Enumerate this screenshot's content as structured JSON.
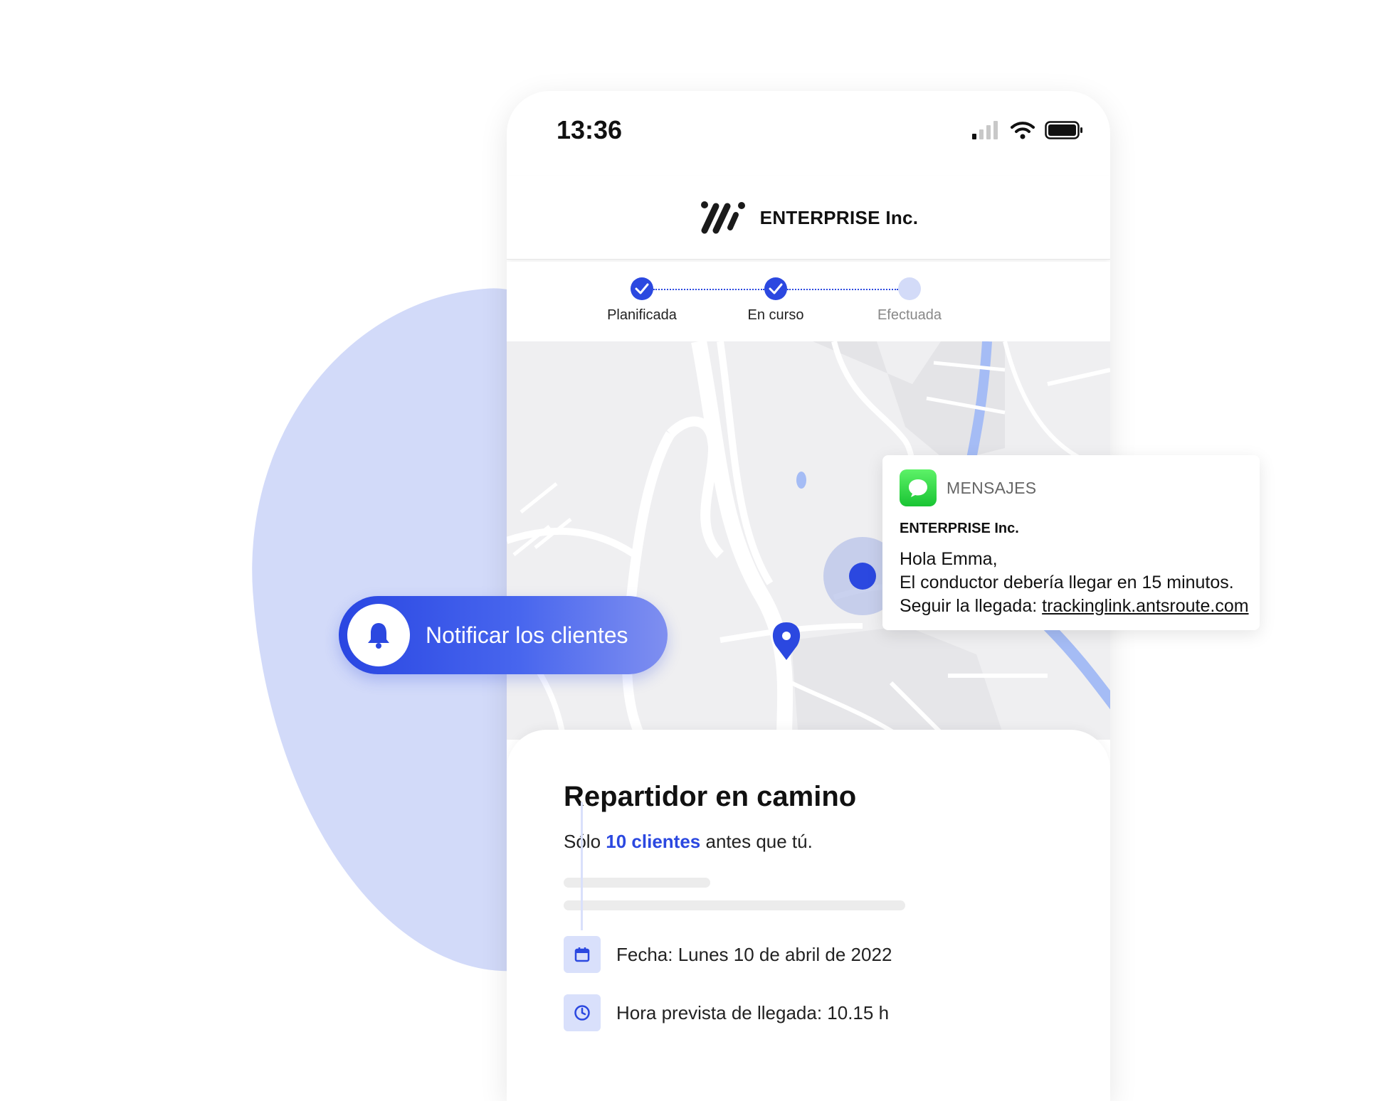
{
  "status_bar": {
    "time": "13:36"
  },
  "header": {
    "brand_name": "ENTERPRISE Inc."
  },
  "progress": {
    "steps": [
      {
        "label": "Planificada",
        "state": "done"
      },
      {
        "label": "En curso",
        "state": "done"
      },
      {
        "label": "Efectuada",
        "state": "pending"
      }
    ]
  },
  "notify": {
    "label": "Notificar los clientes"
  },
  "message": {
    "app_name": "MENSAJES",
    "sender": "ENTERPRISE Inc.",
    "line1": "Hola Emma,",
    "line2": "El conductor debería llegar en 15 minutos.",
    "line3_prefix": "Seguir la llegada: ",
    "link": "trackinglink.antsroute.com"
  },
  "card": {
    "title": "Repartidor en camino",
    "sub_prefix": "Sólo",
    "sub_highlight": "10 clientes",
    "sub_suffix": "antes que tú.",
    "date_text": "Fecha: Lunes 10 de abril de 2022",
    "eta_text": "Hora prevista de llegada: 10.15 h"
  },
  "colors": {
    "accent": "#2b48e0",
    "accent_light": "#d3dbf8",
    "blob": "#d2daf9",
    "map_bg": "#efeff1",
    "messages_green": "#28c840"
  },
  "icons": [
    "signal-icon",
    "wifi-icon",
    "battery-icon",
    "brand-logo-icon",
    "check-icon",
    "bell-icon",
    "messages-app-icon",
    "calendar-icon",
    "clock-icon",
    "map-pin-icon"
  ]
}
